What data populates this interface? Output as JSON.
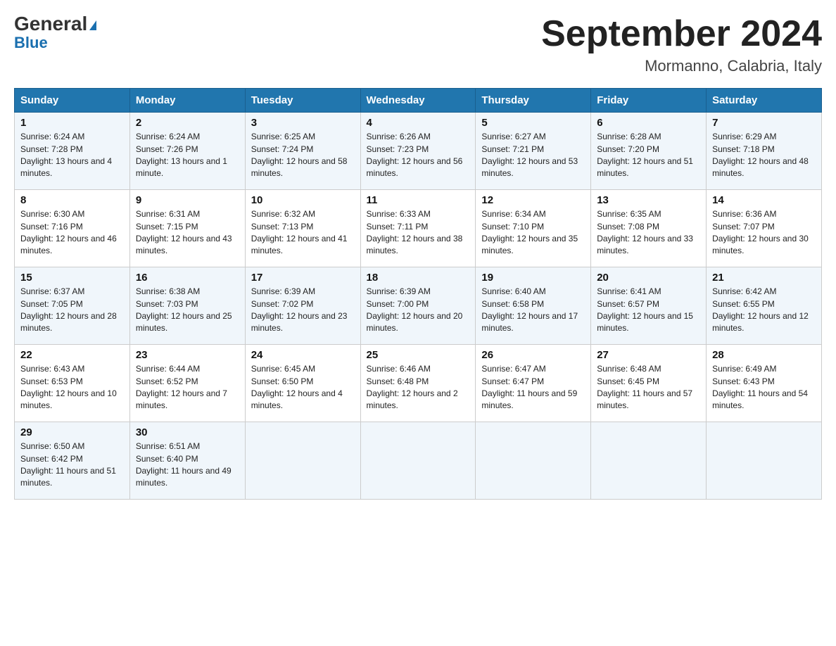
{
  "logo": {
    "general": "General",
    "blue": "Blue",
    "triangle": "▲"
  },
  "title": "September 2024",
  "location": "Mormanno, Calabria, Italy",
  "days_of_week": [
    "Sunday",
    "Monday",
    "Tuesday",
    "Wednesday",
    "Thursday",
    "Friday",
    "Saturday"
  ],
  "weeks": [
    [
      {
        "day": "1",
        "sunrise": "6:24 AM",
        "sunset": "7:28 PM",
        "daylight": "13 hours and 4 minutes."
      },
      {
        "day": "2",
        "sunrise": "6:24 AM",
        "sunset": "7:26 PM",
        "daylight": "13 hours and 1 minute."
      },
      {
        "day": "3",
        "sunrise": "6:25 AM",
        "sunset": "7:24 PM",
        "daylight": "12 hours and 58 minutes."
      },
      {
        "day": "4",
        "sunrise": "6:26 AM",
        "sunset": "7:23 PM",
        "daylight": "12 hours and 56 minutes."
      },
      {
        "day": "5",
        "sunrise": "6:27 AM",
        "sunset": "7:21 PM",
        "daylight": "12 hours and 53 minutes."
      },
      {
        "day": "6",
        "sunrise": "6:28 AM",
        "sunset": "7:20 PM",
        "daylight": "12 hours and 51 minutes."
      },
      {
        "day": "7",
        "sunrise": "6:29 AM",
        "sunset": "7:18 PM",
        "daylight": "12 hours and 48 minutes."
      }
    ],
    [
      {
        "day": "8",
        "sunrise": "6:30 AM",
        "sunset": "7:16 PM",
        "daylight": "12 hours and 46 minutes."
      },
      {
        "day": "9",
        "sunrise": "6:31 AM",
        "sunset": "7:15 PM",
        "daylight": "12 hours and 43 minutes."
      },
      {
        "day": "10",
        "sunrise": "6:32 AM",
        "sunset": "7:13 PM",
        "daylight": "12 hours and 41 minutes."
      },
      {
        "day": "11",
        "sunrise": "6:33 AM",
        "sunset": "7:11 PM",
        "daylight": "12 hours and 38 minutes."
      },
      {
        "day": "12",
        "sunrise": "6:34 AM",
        "sunset": "7:10 PM",
        "daylight": "12 hours and 35 minutes."
      },
      {
        "day": "13",
        "sunrise": "6:35 AM",
        "sunset": "7:08 PM",
        "daylight": "12 hours and 33 minutes."
      },
      {
        "day": "14",
        "sunrise": "6:36 AM",
        "sunset": "7:07 PM",
        "daylight": "12 hours and 30 minutes."
      }
    ],
    [
      {
        "day": "15",
        "sunrise": "6:37 AM",
        "sunset": "7:05 PM",
        "daylight": "12 hours and 28 minutes."
      },
      {
        "day": "16",
        "sunrise": "6:38 AM",
        "sunset": "7:03 PM",
        "daylight": "12 hours and 25 minutes."
      },
      {
        "day": "17",
        "sunrise": "6:39 AM",
        "sunset": "7:02 PM",
        "daylight": "12 hours and 23 minutes."
      },
      {
        "day": "18",
        "sunrise": "6:39 AM",
        "sunset": "7:00 PM",
        "daylight": "12 hours and 20 minutes."
      },
      {
        "day": "19",
        "sunrise": "6:40 AM",
        "sunset": "6:58 PM",
        "daylight": "12 hours and 17 minutes."
      },
      {
        "day": "20",
        "sunrise": "6:41 AM",
        "sunset": "6:57 PM",
        "daylight": "12 hours and 15 minutes."
      },
      {
        "day": "21",
        "sunrise": "6:42 AM",
        "sunset": "6:55 PM",
        "daylight": "12 hours and 12 minutes."
      }
    ],
    [
      {
        "day": "22",
        "sunrise": "6:43 AM",
        "sunset": "6:53 PM",
        "daylight": "12 hours and 10 minutes."
      },
      {
        "day": "23",
        "sunrise": "6:44 AM",
        "sunset": "6:52 PM",
        "daylight": "12 hours and 7 minutes."
      },
      {
        "day": "24",
        "sunrise": "6:45 AM",
        "sunset": "6:50 PM",
        "daylight": "12 hours and 4 minutes."
      },
      {
        "day": "25",
        "sunrise": "6:46 AM",
        "sunset": "6:48 PM",
        "daylight": "12 hours and 2 minutes."
      },
      {
        "day": "26",
        "sunrise": "6:47 AM",
        "sunset": "6:47 PM",
        "daylight": "11 hours and 59 minutes."
      },
      {
        "day": "27",
        "sunrise": "6:48 AM",
        "sunset": "6:45 PM",
        "daylight": "11 hours and 57 minutes."
      },
      {
        "day": "28",
        "sunrise": "6:49 AM",
        "sunset": "6:43 PM",
        "daylight": "11 hours and 54 minutes."
      }
    ],
    [
      {
        "day": "29",
        "sunrise": "6:50 AM",
        "sunset": "6:42 PM",
        "daylight": "11 hours and 51 minutes."
      },
      {
        "day": "30",
        "sunrise": "6:51 AM",
        "sunset": "6:40 PM",
        "daylight": "11 hours and 49 minutes."
      },
      {
        "day": "",
        "sunrise": "",
        "sunset": "",
        "daylight": ""
      },
      {
        "day": "",
        "sunrise": "",
        "sunset": "",
        "daylight": ""
      },
      {
        "day": "",
        "sunrise": "",
        "sunset": "",
        "daylight": ""
      },
      {
        "day": "",
        "sunrise": "",
        "sunset": "",
        "daylight": ""
      },
      {
        "day": "",
        "sunrise": "",
        "sunset": "",
        "daylight": ""
      }
    ]
  ],
  "labels": {
    "sunrise": "Sunrise: ",
    "sunset": "Sunset: ",
    "daylight": "Daylight: "
  }
}
